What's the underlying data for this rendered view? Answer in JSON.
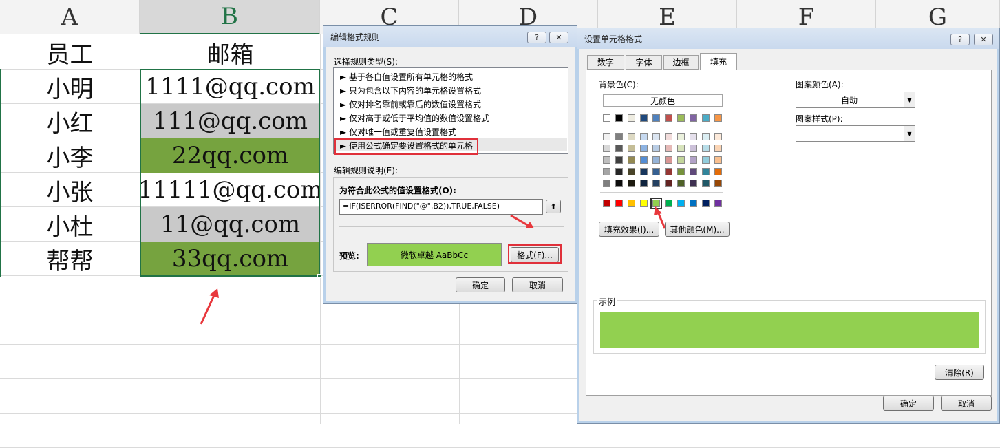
{
  "sheet": {
    "columns": [
      "A",
      "B",
      "C",
      "D",
      "E",
      "F",
      "G"
    ],
    "header_row": {
      "a": "员工",
      "b": "邮箱"
    },
    "rows": [
      {
        "a": "小明",
        "b": "1111@qq.com",
        "fill": "none"
      },
      {
        "a": "小红",
        "b": "111@qq.com",
        "fill": "gray"
      },
      {
        "a": "小李",
        "b": "22qq.com",
        "fill": "green"
      },
      {
        "a": "小张",
        "b": "11111@qq.com",
        "fill": "none"
      },
      {
        "a": "小杜",
        "b": "11@qq.com",
        "fill": "gray"
      },
      {
        "a": "帮帮",
        "b": "33qq.com",
        "fill": "green"
      }
    ],
    "colors": {
      "gray": "#c9c9c9",
      "green": "#76a33f",
      "accent": "#217346"
    }
  },
  "rule_dialog": {
    "title": "编辑格式规则",
    "help": "?",
    "close": "✕",
    "select_type_label": "选择规则类型(S):",
    "rule_types": [
      "► 基于各自值设置所有单元格的格式",
      "► 只为包含以下内容的单元格设置格式",
      "► 仅对排名靠前或靠后的数值设置格式",
      "► 仅对高于或低于平均值的数值设置格式",
      "► 仅对唯一值或重复值设置格式",
      "► 使用公式确定要设置格式的单元格"
    ],
    "edit_desc_label": "编辑规则说明(E):",
    "formula_label": "为符合此公式的值设置格式(O):",
    "formula": "=IF(ISERROR(FIND(\"@\",B2)),TRUE,FALSE)",
    "collapse_btn": "⬆",
    "preview_label": "预览:",
    "preview_text": "微软卓越  AaBbCc",
    "format_btn": "格式(F)...",
    "ok": "确定",
    "cancel": "取消"
  },
  "cell_dialog": {
    "title": "设置单元格格式",
    "help": "?",
    "close": "✕",
    "tabs": [
      "数字",
      "字体",
      "边框",
      "填充"
    ],
    "active_tab": "填充",
    "bg_label": "背景色(C):",
    "no_color": "无颜色",
    "pattern_color_label": "图案颜色(A):",
    "pattern_color_value": "自动",
    "pattern_style_label": "图案样式(P):",
    "pattern_style_value": "",
    "fill_effects_btn": "填充效果(I)...",
    "more_colors_btn": "其他颜色(M)...",
    "sample_label": "示例",
    "sample_color": "#92d050",
    "clear_btn": "清除(R)",
    "ok": "确定",
    "cancel": "取消",
    "theme_row": [
      "#ffffff",
      "#000000",
      "#eeece1",
      "#1f497d",
      "#4f81bd",
      "#c0504d",
      "#9bbb59",
      "#8064a2",
      "#4bacc6",
      "#f79646"
    ],
    "shade_rows": [
      [
        "#f2f2f2",
        "#7f7f7f",
        "#ddd9c3",
        "#c6d9f0",
        "#dbe5f1",
        "#f2dcdb",
        "#ebf1dd",
        "#e5e0ec",
        "#dbeef3",
        "#fdeada"
      ],
      [
        "#d8d8d8",
        "#595959",
        "#c4bd97",
        "#8db3e2",
        "#b8cce4",
        "#e5b9b7",
        "#d7e3bc",
        "#ccc1d9",
        "#b7dde8",
        "#fbd5b5"
      ],
      [
        "#bfbfbf",
        "#3f3f3f",
        "#938953",
        "#548dd4",
        "#95b3d7",
        "#d99694",
        "#c3d69b",
        "#b2a2c7",
        "#92cddc",
        "#fac08f"
      ],
      [
        "#a5a5a5",
        "#262626",
        "#494429",
        "#17365d",
        "#366092",
        "#953734",
        "#76923c",
        "#5f497a",
        "#31859b",
        "#e36c09"
      ],
      [
        "#7f7f7f",
        "#0c0c0c",
        "#1d1b10",
        "#0f243e",
        "#244061",
        "#632423",
        "#4f6128",
        "#3f3151",
        "#205867",
        "#974806"
      ]
    ],
    "standard_row": [
      "#c00000",
      "#ff0000",
      "#ffc000",
      "#ffff00",
      "#92d050",
      "#00b050",
      "#00b0f0",
      "#0070c0",
      "#002060",
      "#7030a0"
    ],
    "selected_standard_index": 4
  }
}
